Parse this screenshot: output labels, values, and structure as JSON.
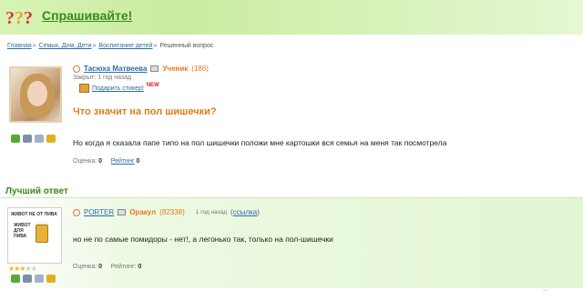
{
  "header": {
    "site_name": "Спрашивайте!",
    "logo_icon": "question-marks-icon"
  },
  "breadcrumbs": {
    "items": [
      "Главная",
      "Семья, Дом, Дети",
      "Воспитание детей"
    ],
    "current": "Решенный вопрос",
    "separator": "»"
  },
  "question": {
    "user_name": "Тасюха Матвеева",
    "user_rank": "Ученик",
    "user_points": "(186)",
    "closed_text": "Закрыт: 1 год назад",
    "gift_label": "Подарить стикер!",
    "gift_badge": "NEW",
    "title": "Что значит на пол шишечки?",
    "body": "Но когда я сказала папе типо на пол шишечки положи мне картошки вся семья на меня так посмотрела",
    "score_label": "Оценка:",
    "score_value": "0",
    "rating_label": "Рейтинг",
    "rating_value": "0"
  },
  "best_answer": {
    "section_label": "Лучший ответ",
    "avatar_text_top": "ЖИВОТ НЕ ОТ ПИВА",
    "avatar_text_mid": "ЖИВОТ ДЛЯ ПИВА",
    "user_name": "PORTER",
    "user_rank": "Оракул",
    "user_points": "(82338)",
    "time_ago": "1 год назад",
    "link_text": "ссылка",
    "body": "но не по самые помидоры - нет!, а легонько так, только на пол-шишечки",
    "score_label": "Оценка:",
    "score_value": "0",
    "rating_label": "Рейтинг:",
    "rating_value": "0",
    "stars_filled": 3,
    "stars_total": 5
  },
  "footer": {
    "corner_text": "..."
  },
  "colors": {
    "accent_green": "#3a8a1a",
    "accent_orange": "#e07b1a",
    "link_blue": "#2a6da5"
  }
}
